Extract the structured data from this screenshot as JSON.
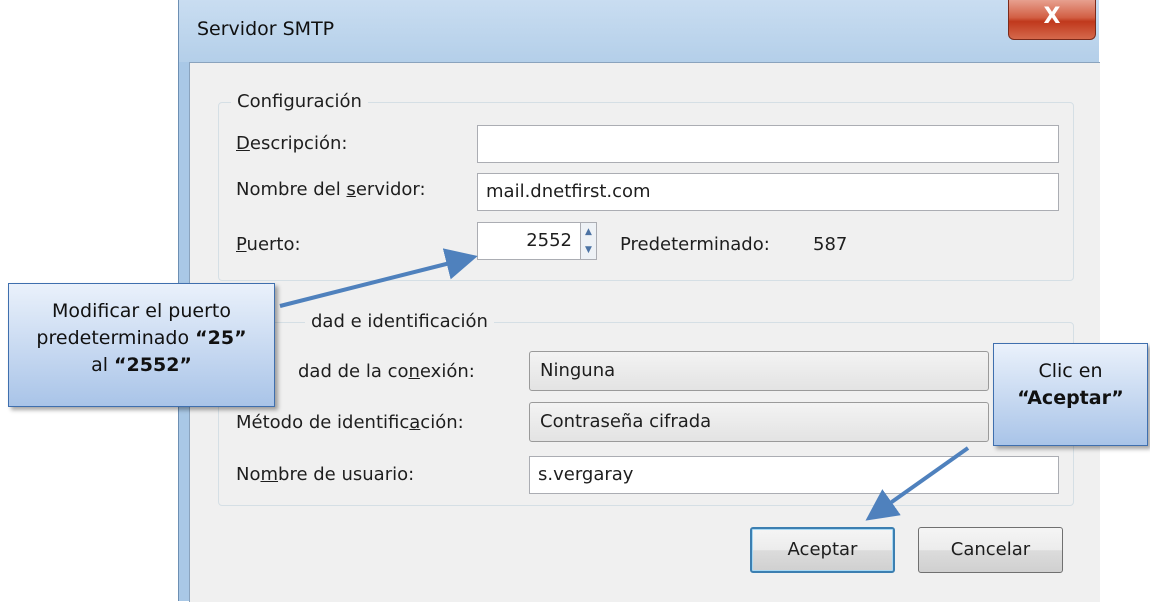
{
  "window": {
    "title": "Servidor SMTP",
    "close_symbol": "X"
  },
  "config_group": {
    "legend": "Configuración",
    "description": {
      "label_u": "D",
      "label_rest": "escripción:",
      "value": ""
    },
    "server": {
      "label_pre": "Nombre del ",
      "label_u": "s",
      "label_post": "ervidor:",
      "value": "mail.dnetfirst.com"
    },
    "port": {
      "label_u": "P",
      "label_rest": "uerto:",
      "value": "2552",
      "default_label": "Predeterminado:",
      "default_value": "587"
    }
  },
  "security_group": {
    "legend_visible": "dad e identificación",
    "connection_security": {
      "label_visible_pre": "dad de la co",
      "label_u": "n",
      "label_post": "exión:",
      "value": "Ninguna"
    },
    "auth_method": {
      "label_pre": "Método de identific",
      "label_u": "a",
      "label_post": "ción:",
      "value": "Contraseña cifrada"
    },
    "username": {
      "label_pre": "No",
      "label_u": "m",
      "label_post": "bre de usuario:",
      "value": "s.vergaray"
    }
  },
  "buttons": {
    "ok": "Aceptar",
    "cancel": "Cancelar"
  },
  "callouts": {
    "port_note": {
      "line1": "Modificar el puerto",
      "line2_pre": "predeterminado ",
      "line2_bold": "“25”",
      "line3_pre": "al ",
      "line3_bold": "“2552”"
    },
    "ok_note": {
      "line1": "Clic en",
      "line2_bold": "“Aceptar”"
    }
  },
  "colors": {
    "window_frame": "#a9c8e6",
    "client_bg": "#f0f0f0",
    "close_button": "#c0381c",
    "callout_border": "#3f6fae",
    "arrow": "#4f81bd"
  },
  "icons": [
    "close-icon",
    "spin-up-icon",
    "spin-down-icon",
    "dropdown-arrow-icon"
  ]
}
